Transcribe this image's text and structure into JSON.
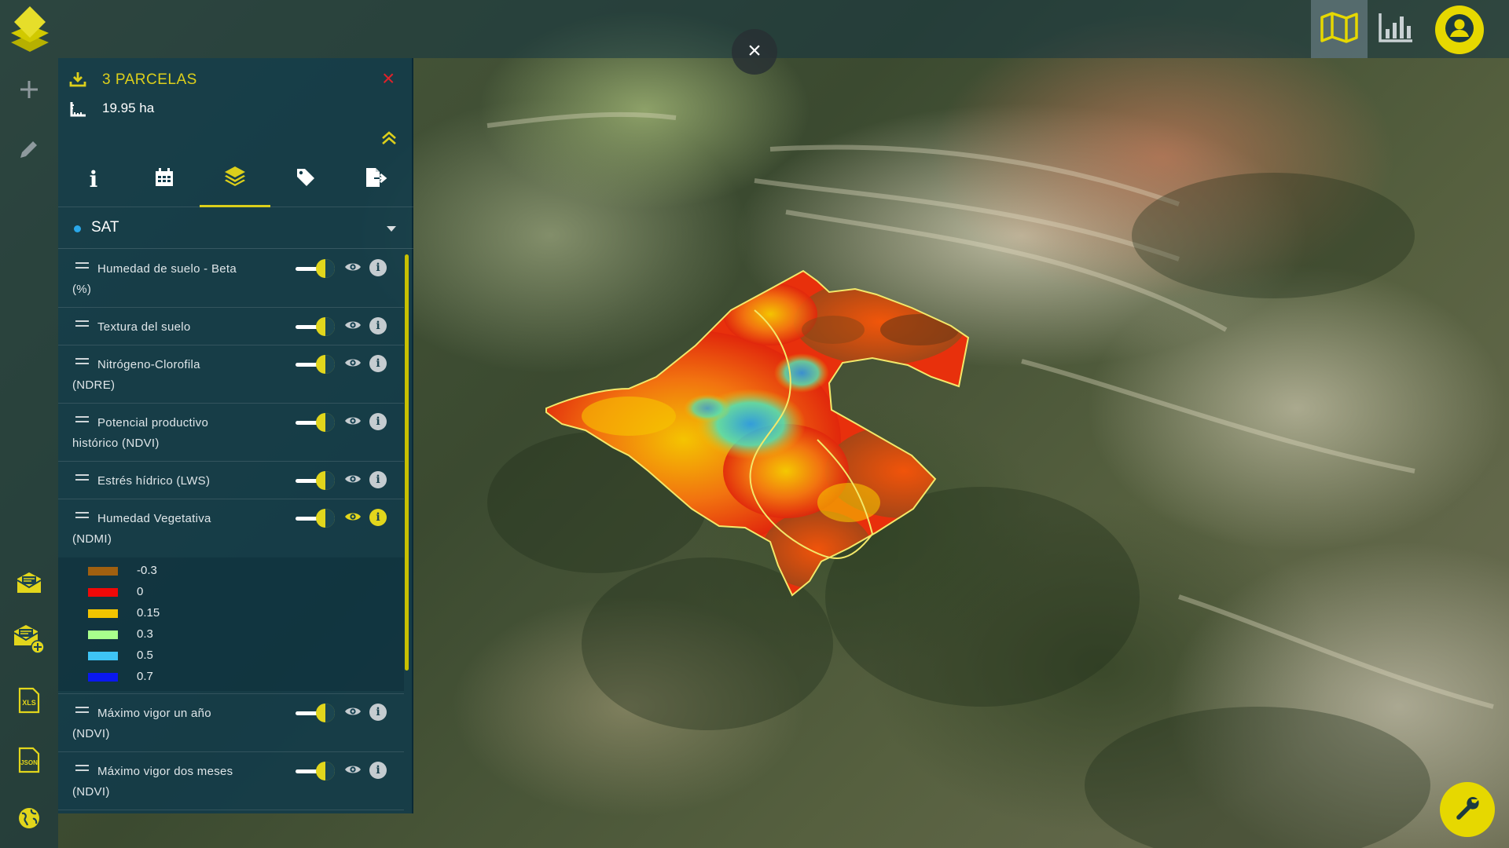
{
  "topbar": {
    "logo_icon": "stacked-layers-logo",
    "close_map_label": "×",
    "map_view_icon": "map-icon",
    "stats_icon": "bar-chart-icon",
    "user_icon": "user-icon",
    "accent": "#e6d800"
  },
  "leftrail": {
    "items": [
      {
        "icon": "plus-icon"
      },
      {
        "icon": "pencil-icon"
      },
      {
        "icon": "mail-report-icon"
      },
      {
        "icon": "mail-add-icon"
      },
      {
        "icon": "xls-file-icon",
        "label": "XLS"
      },
      {
        "icon": "json-file-icon",
        "label": "JSON"
      },
      {
        "icon": "globe-icon"
      }
    ]
  },
  "panel": {
    "title": "3 PARCELAS",
    "area": "19.95 ha",
    "close_label": "×",
    "tabs": [
      {
        "name": "info",
        "icon": "info-icon",
        "label": "i"
      },
      {
        "name": "calendar",
        "icon": "calendar-icon"
      },
      {
        "name": "layers",
        "icon": "layers-icon",
        "active": true
      },
      {
        "name": "tags",
        "icon": "tag-icon"
      },
      {
        "name": "export",
        "icon": "export-icon"
      }
    ],
    "source": {
      "dot_color": "#2aa7e8",
      "label": "SAT"
    },
    "layers": [
      {
        "name": "Humedad de suelo - Beta (%)",
        "enabled": true
      },
      {
        "name": "Textura del suelo",
        "enabled": true
      },
      {
        "name": "Nitrógeno-Clorofila (NDRE)",
        "enabled": true
      },
      {
        "name": "Potencial productivo histórico (NDVI)",
        "enabled": true
      },
      {
        "name": "Estrés hídrico (LWS)",
        "enabled": true
      },
      {
        "name": "Humedad Vegetativa (NDMI)",
        "enabled": true,
        "active": true
      },
      {
        "name": "Máximo vigor un año (NDVI)",
        "enabled": true
      },
      {
        "name": "Máximo vigor dos meses (NDVI)",
        "enabled": true
      }
    ],
    "info_label": "i",
    "legend": [
      {
        "value": "-0.3",
        "color": "#a06010"
      },
      {
        "value": "0",
        "color": "#f00808"
      },
      {
        "value": "0.15",
        "color": "#f2c400"
      },
      {
        "value": "0.3",
        "color": "#a8ff8c"
      },
      {
        "value": "0.5",
        "color": "#3ec4f5"
      },
      {
        "value": "0.7",
        "color": "#0a18f0"
      }
    ]
  },
  "wrench_icon": "wrench-icon"
}
